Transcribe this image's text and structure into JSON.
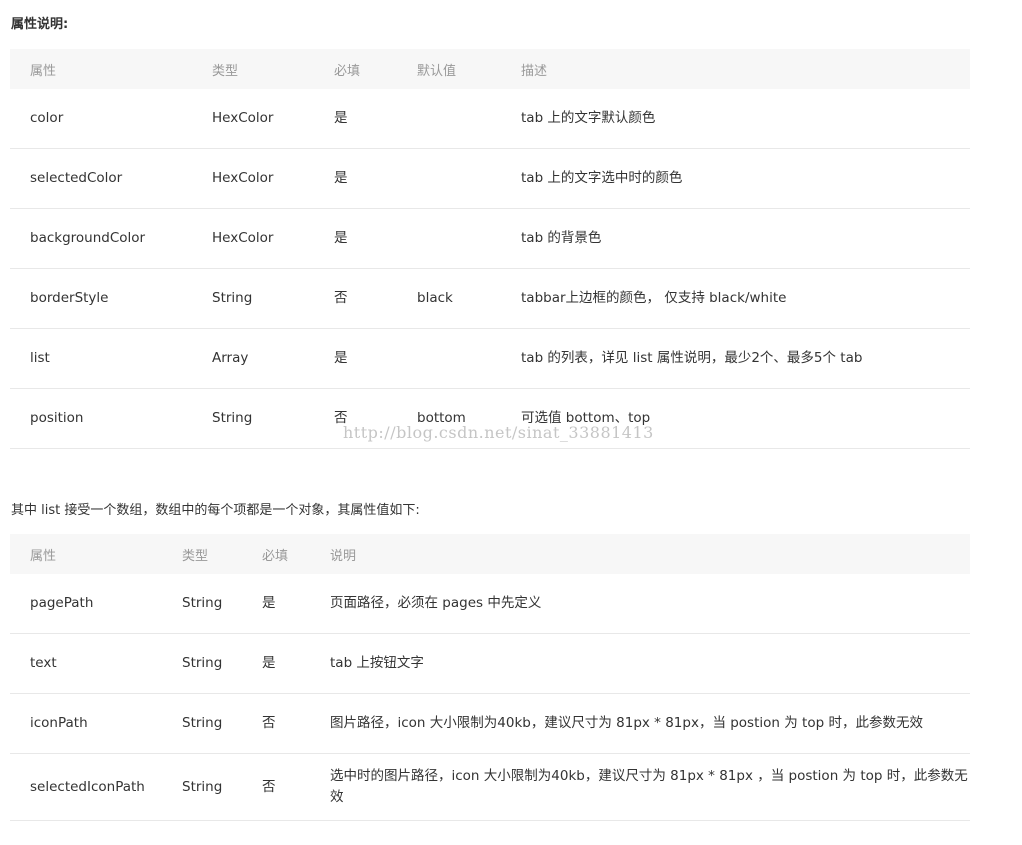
{
  "section_title": "属性说明:",
  "table1": {
    "headers": [
      "属性",
      "类型",
      "必填",
      "默认值",
      "描述"
    ],
    "rows": [
      [
        "color",
        "HexColor",
        "是",
        "",
        "tab 上的文字默认颜色"
      ],
      [
        "selectedColor",
        "HexColor",
        "是",
        "",
        "tab 上的文字选中时的颜色"
      ],
      [
        "backgroundColor",
        "HexColor",
        "是",
        "",
        "tab 的背景色"
      ],
      [
        "borderStyle",
        "String",
        "否",
        "black",
        "tabbar上边框的颜色， 仅支持 black/white"
      ],
      [
        "list",
        "Array",
        "是",
        "",
        "tab 的列表，详见 list 属性说明，最少2个、最多5个 tab"
      ],
      [
        "position",
        "String",
        "否",
        "bottom",
        "可选值 bottom、top"
      ]
    ]
  },
  "watermark": "http://blog.csdn.net/sinat_33881413",
  "intro": "其中 list 接受一个数组，数组中的每个项都是一个对象，其属性值如下:",
  "table2": {
    "headers": [
      "属性",
      "类型",
      "必填",
      "说明"
    ],
    "rows": [
      [
        "pagePath",
        "String",
        "是",
        "页面路径，必须在 pages 中先定义"
      ],
      [
        "text",
        "String",
        "是",
        "tab 上按钮文字"
      ],
      [
        "iconPath",
        "String",
        "否",
        "图片路径，icon 大小限制为40kb，建议尺寸为 81px * 81px，当 postion 为 top 时，此参数无效"
      ],
      [
        "selectedIconPath",
        "String",
        "否",
        "选中时的图片路径，icon 大小限制为40kb，建议尺寸为 81px * 81px ，当 postion 为 top 时，此参数无效"
      ]
    ]
  }
}
